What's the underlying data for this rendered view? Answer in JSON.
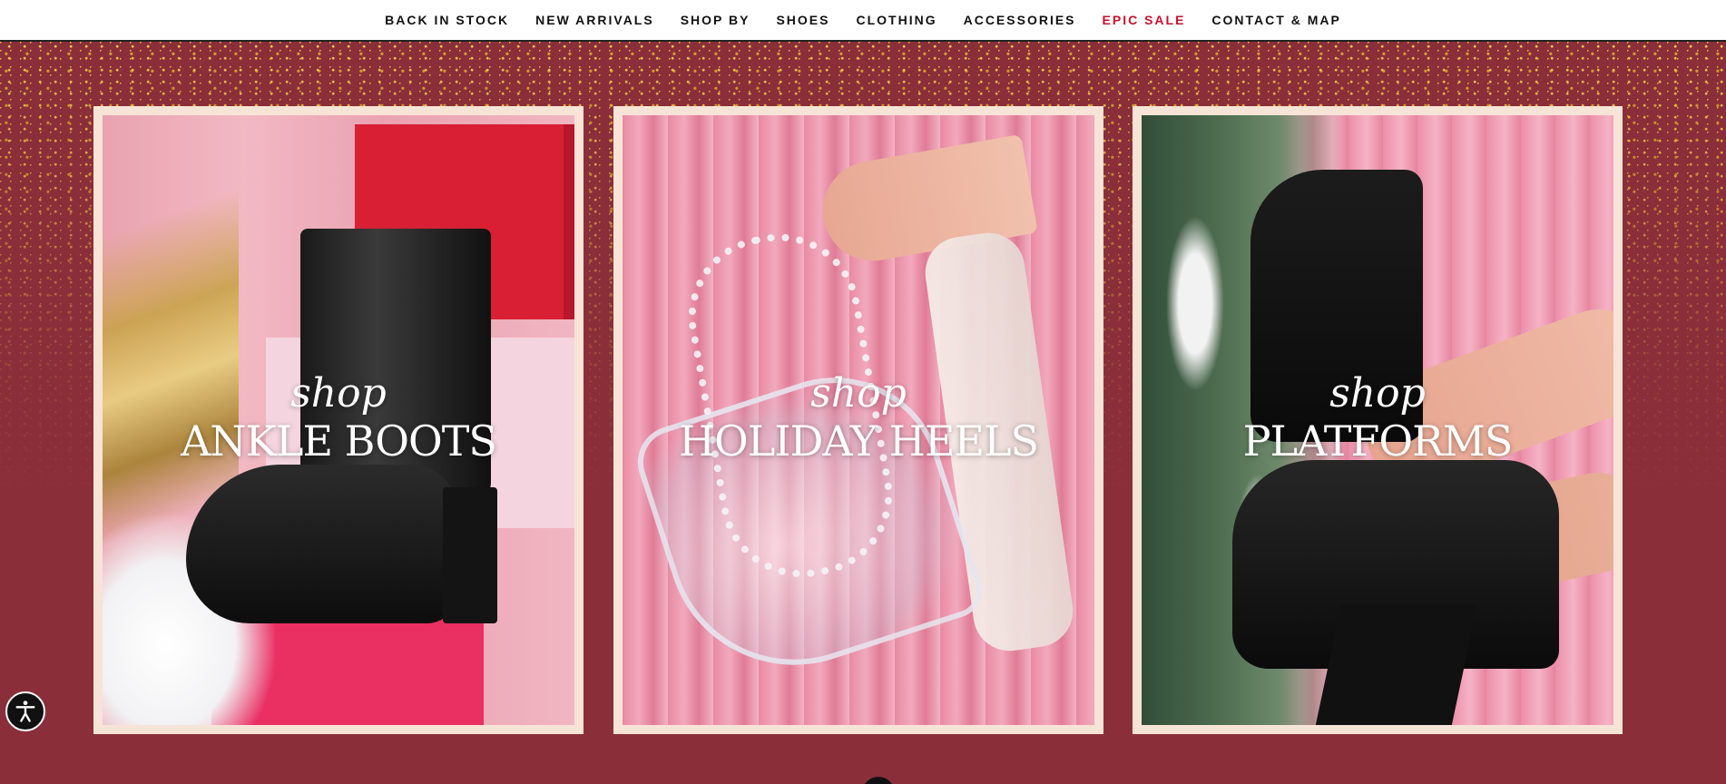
{
  "nav": {
    "items": [
      {
        "label": "BACK IN STOCK"
      },
      {
        "label": "NEW ARRIVALS"
      },
      {
        "label": "SHOP BY"
      },
      {
        "label": "SHOES"
      },
      {
        "label": "CLOTHING"
      },
      {
        "label": "ACCESSORIES"
      },
      {
        "label": "EPIC SALE"
      },
      {
        "label": "CONTACT & MAP"
      }
    ],
    "sale_color": "#c8102e"
  },
  "colors": {
    "background": "#8a2f3a",
    "card_frame": "#f7e4d7",
    "glitter": "#e9b93a"
  },
  "cards": [
    {
      "kicker": "shop",
      "title": "ANKLE BOOTS"
    },
    {
      "kicker": "shop",
      "title": "HOLIDAY HEELS"
    },
    {
      "kicker": "shop",
      "title": "PLATFORMS"
    }
  ],
  "icons": {
    "accessibility": "accessibility-icon"
  }
}
